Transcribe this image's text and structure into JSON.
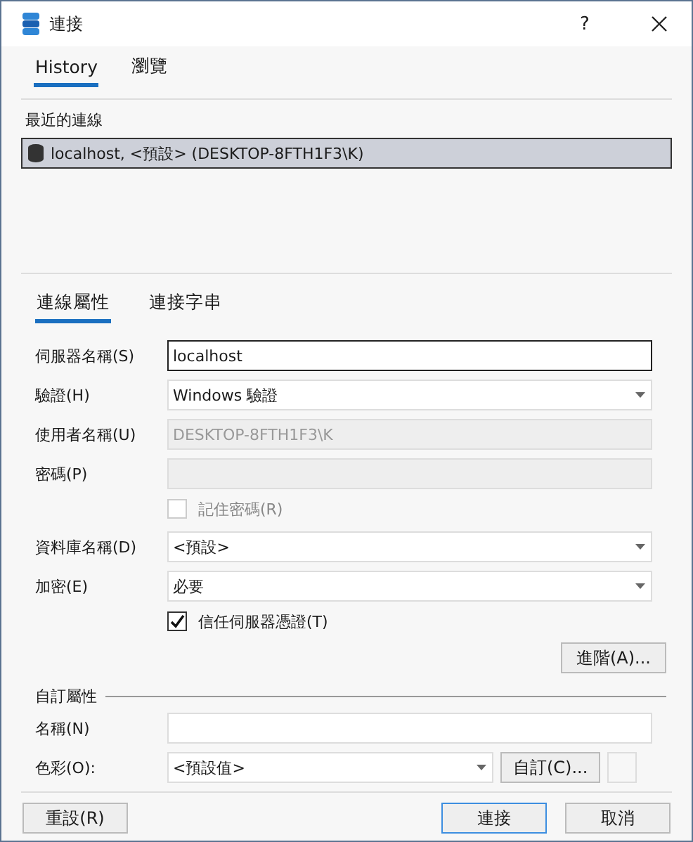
{
  "window": {
    "title": "連接",
    "help": "?"
  },
  "top_tabs": [
    {
      "label": "History",
      "selected": true
    },
    {
      "label": "瀏覽",
      "selected": false
    }
  ],
  "recent": {
    "label": "最近的連線",
    "items": [
      {
        "text": "localhost, <預設> (DESKTOP-8FTH1F3\\K)",
        "selected": true
      }
    ]
  },
  "property_tabs": [
    {
      "label": "連線屬性",
      "selected": true
    },
    {
      "label": "連接字串",
      "selected": false
    }
  ],
  "fields": [
    {
      "kind": "text",
      "label": "伺服器名稱(S)",
      "value": "localhost",
      "disabled": false,
      "focused": true
    },
    {
      "kind": "select",
      "label": "驗證(H)",
      "value": "Windows 驗證",
      "disabled": false
    },
    {
      "kind": "text",
      "label": "使用者名稱(U)",
      "value": "DESKTOP-8FTH1F3\\K",
      "disabled": true,
      "focused": false
    },
    {
      "kind": "text",
      "label": "密碼(P)",
      "disabled": true,
      "focused": false
    },
    {
      "kind": "checkbox",
      "label": "記住密碼(R)",
      "checked": false,
      "disabled": true
    },
    {
      "kind": "select",
      "label": "資料庫名稱(D)",
      "value": "<預設>",
      "disabled": false
    },
    {
      "kind": "select",
      "label": "加密(E)",
      "value": "必要",
      "disabled": false
    },
    {
      "kind": "checkbox",
      "label": "信任伺服器憑證(T)",
      "checked": true,
      "disabled": false
    }
  ],
  "advanced_button": "進階(A)...",
  "custom": {
    "title": "自訂屬性",
    "name_label": "名稱(N)",
    "color_label": "色彩(O):",
    "color_value": "<預設值>",
    "custom_button": "自訂(C)..."
  },
  "footer": [
    {
      "label": "重設(R)",
      "default": false
    },
    {
      "label": "連接",
      "default": true
    },
    {
      "label": "取消",
      "default": false
    }
  ]
}
